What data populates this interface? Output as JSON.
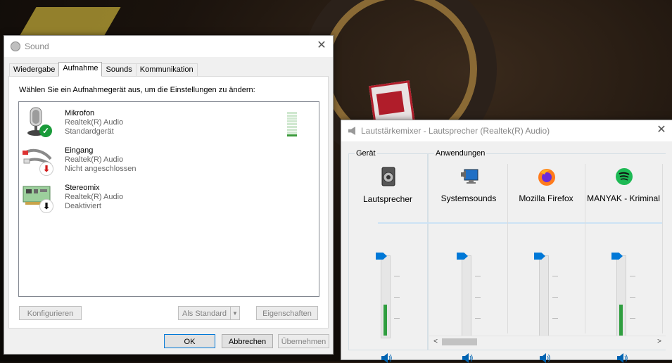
{
  "sound": {
    "title": "Sound",
    "tabs": [
      "Wiedergabe",
      "Aufnahme",
      "Sounds",
      "Kommunikation"
    ],
    "instruction": "Wählen Sie ein Aufnahmegerät aus, um die Einstellungen zu ändern:",
    "devices": [
      {
        "name": "Mikrofon",
        "driver": "Realtek(R) Audio",
        "state": "Standardgerät",
        "icon": "microphone-icon",
        "badge": "check-icon"
      },
      {
        "name": "Eingang",
        "driver": "Realtek(R) Audio",
        "state": "Nicht angeschlossen",
        "icon": "line-in-cable-icon",
        "badge": "red-down-arrow-icon"
      },
      {
        "name": "Stereomix",
        "driver": "Realtek(R) Audio",
        "state": "Deaktiviert",
        "icon": "sound-card-icon",
        "badge": "black-down-arrow-icon"
      }
    ],
    "buttons": {
      "configure": "Konfigurieren",
      "set_default": "Als Standard",
      "properties": "Eigenschaften",
      "ok": "OK",
      "cancel": "Abbrechen",
      "apply": "Übernehmen"
    }
  },
  "mixer": {
    "title": "Lautstärkemixer - Lautsprecher (Realtek(R) Audio)",
    "device_group": "Gerät",
    "apps_group": "Anwendungen",
    "channels": [
      {
        "label": "Lautsprecher",
        "icon": "speaker-device-icon",
        "level": 0.4
      },
      {
        "label": "Systemsounds",
        "icon": "system-sounds-icon",
        "level": 0.0
      },
      {
        "label": "Mozilla Firefox",
        "icon": "firefox-icon",
        "level": 0.0
      },
      {
        "label": "MANYAK - Kriminal",
        "icon": "spotify-icon",
        "level": 0.4
      }
    ]
  },
  "colors": {
    "accent": "#0078d7",
    "meter_green": "#2f9e3f",
    "check_green": "#1a9b3a",
    "arrow_red": "#d11a1a"
  }
}
